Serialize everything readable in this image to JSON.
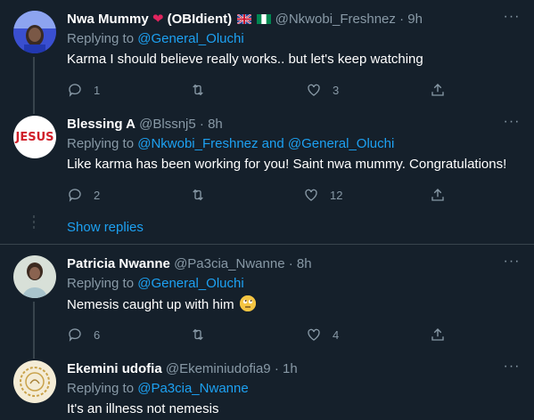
{
  "colors": {
    "background": "#15202b",
    "link": "#1da1f2",
    "muted": "#8899a6",
    "divider": "#38444d"
  },
  "tweets": [
    {
      "name": "Nwa Mummy",
      "name_suffix": "(OBIdient)",
      "handle": "@Nkwobi_Freshnez",
      "separator": "·",
      "time": "9h",
      "replying_label": "Replying to",
      "replying_to": "@General_Oluchi",
      "text": "Karma I should believe really works.. but let's keep watching",
      "replies": "1",
      "retweets": "",
      "likes": "3"
    },
    {
      "name": "Blessing A",
      "handle": "@Blssnj5",
      "separator": "·",
      "time": "8h",
      "avatar_text": "JESUS",
      "replying_label": "Replying to",
      "replying_to": "@Nkwobi_Freshnez and @General_Oluchi",
      "text": "Like karma has been working for you! Saint nwa mummy. Congratulations!",
      "replies": "2",
      "retweets": "",
      "likes": "12"
    },
    {
      "name": "Patricia Nwanne",
      "handle": "@Pa3cia_Nwanne",
      "separator": "·",
      "time": "8h",
      "replying_label": "Replying to",
      "replying_to": "@General_Oluchi",
      "text": "Nemesis caught up with him",
      "replies": "6",
      "retweets": "",
      "likes": "4"
    },
    {
      "name": "Ekemini udofia",
      "handle": "@Ekeminiudofia9",
      "separator": "·",
      "time": "1h",
      "replying_label": "Replying to",
      "replying_to": "@Pa3cia_Nwanne",
      "text": "It's an illness not nemesis"
    }
  ],
  "show_replies": "Show replies",
  "icons": [
    "reply-icon",
    "retweet-icon",
    "like-icon",
    "share-icon",
    "more-icon"
  ]
}
